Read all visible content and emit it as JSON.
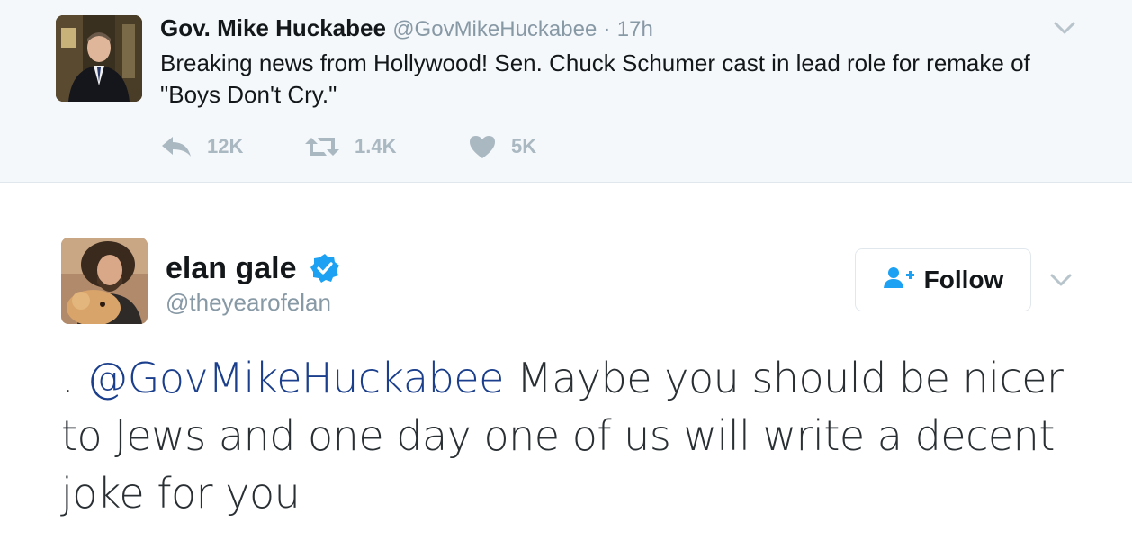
{
  "parent_tweet": {
    "author_name": "Gov. Mike Huckabee",
    "author_handle": "@GovMikeHuckabee",
    "separator": "·",
    "time": "17h",
    "text": "Breaking news from Hollywood!  Sen. Chuck Schumer cast in lead role for remake of \"Boys Don't Cry.\"",
    "actions": {
      "reply_count": "12K",
      "retweet_count": "1.4K",
      "like_count": "5K"
    }
  },
  "main_tweet": {
    "author_name": "elan gale",
    "author_handle": "@theyearofelan",
    "verified": true,
    "follow_label": "Follow",
    "text_prefix": ". ",
    "mention": "@GovMikeHuckabee",
    "text_body": " Maybe you should be nicer to Jews and one day one of us will write a decent joke for you"
  },
  "colors": {
    "icon_gray": "#aab8c2",
    "secondary_text": "#8899a6",
    "mention_blue": "#1b3f8c",
    "verified_blue": "#1da1f2",
    "parent_background": "#f5f8fa"
  },
  "icons": [
    "reply-icon",
    "retweet-icon",
    "heart-icon",
    "verified-badge-icon",
    "follow-person-icon",
    "chevron-down-icon"
  ]
}
